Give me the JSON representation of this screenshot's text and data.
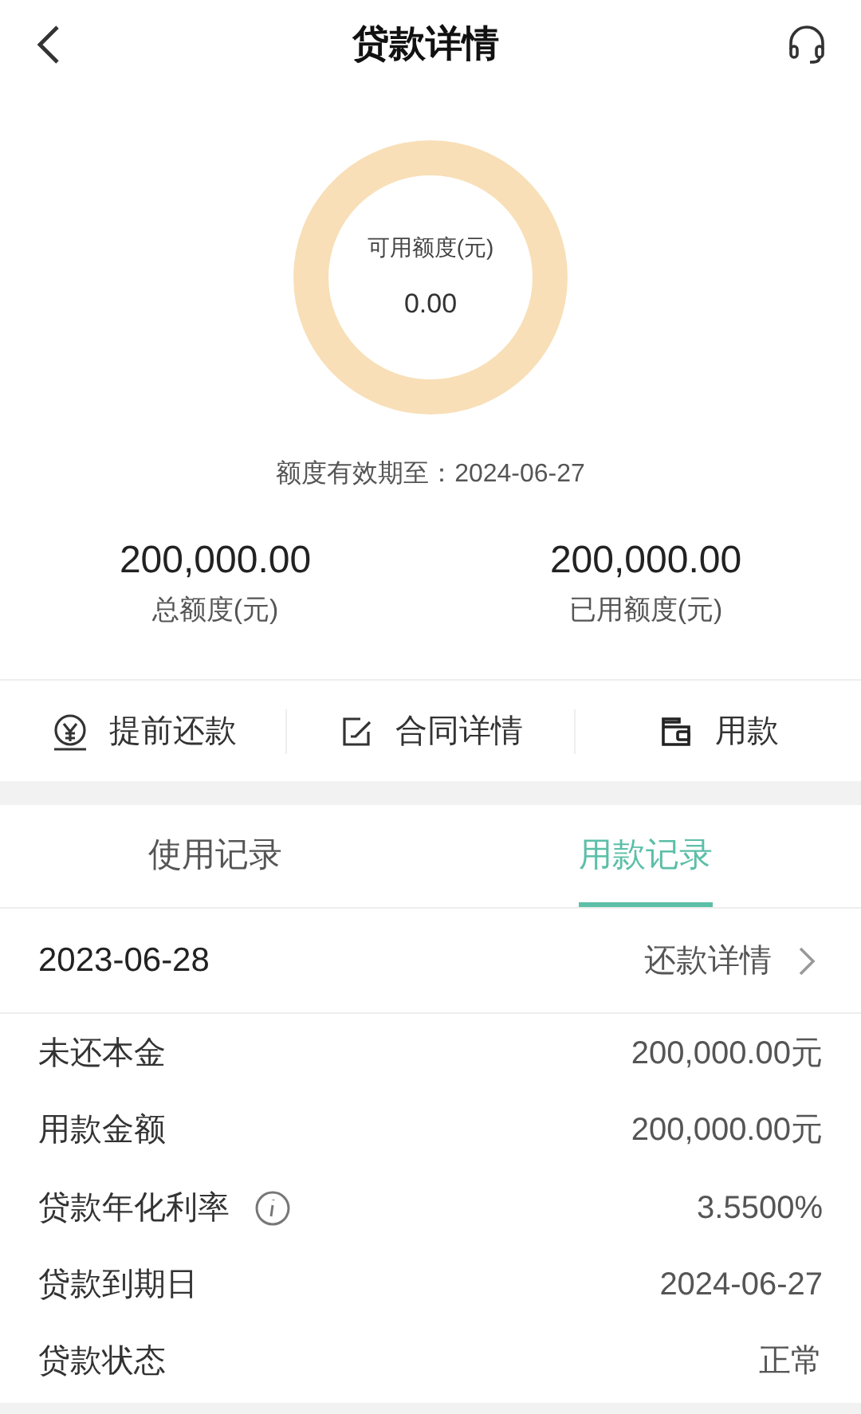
{
  "header": {
    "title": "贷款详情"
  },
  "ring": {
    "label": "可用额度(元)",
    "value": "0.00"
  },
  "validity": "额度有效期至：2024-06-27",
  "totals": [
    {
      "amount": "200,000.00",
      "label": "总额度(元)"
    },
    {
      "amount": "200,000.00",
      "label": "已用额度(元)"
    }
  ],
  "actions": [
    {
      "kind": "yen",
      "label": "提前还款"
    },
    {
      "kind": "edit",
      "label": "合同详情"
    },
    {
      "kind": "wallet",
      "label": "用款"
    }
  ],
  "tabs": [
    {
      "label": "使用记录",
      "selected": false
    },
    {
      "label": "用款记录",
      "selected": true
    }
  ],
  "record": {
    "date": "2023-06-28",
    "link": "还款详情"
  },
  "details": [
    {
      "label": "未还本金",
      "value": "200,000.00元",
      "info": false
    },
    {
      "label": "用款金额",
      "value": "200,000.00元",
      "info": false
    },
    {
      "label": "贷款年化利率",
      "value": "3.5500%",
      "info": true
    },
    {
      "label": "贷款到期日",
      "value": "2024-06-27",
      "info": false
    },
    {
      "label": "贷款状态",
      "value": "正常",
      "info": false
    }
  ]
}
